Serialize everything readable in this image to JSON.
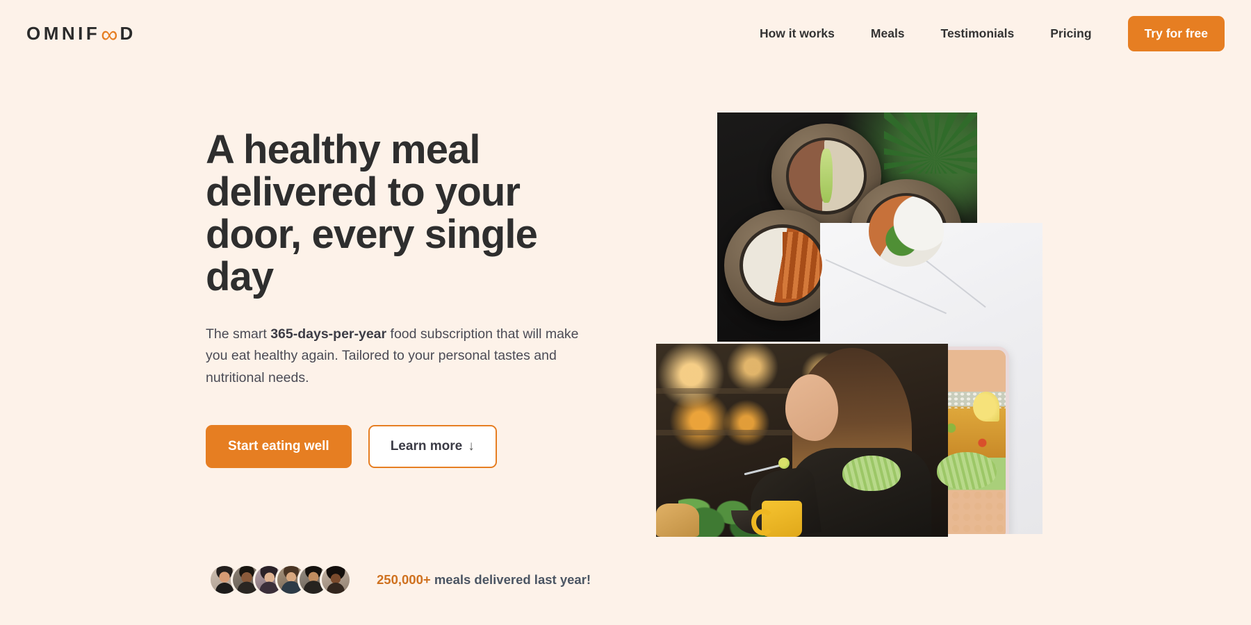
{
  "brand": {
    "name_part1": "OMNIF",
    "name_infinity": "∞",
    "name_part2": "D",
    "accent_color": "#e67e22",
    "background_color": "#fdf2e9",
    "heading_color": "#2e2e2e"
  },
  "nav": {
    "links": [
      {
        "label": "How it works"
      },
      {
        "label": "Meals"
      },
      {
        "label": "Testimonials"
      },
      {
        "label": "Pricing"
      }
    ],
    "cta_label": "Try for free"
  },
  "hero": {
    "title": "A healthy meal delivered to your door, every single day",
    "description_pre": "The smart ",
    "description_bold": "365-days-per-year",
    "description_post": " food subscription that will make you eat healthy again. Tailored to your personal tastes and nutritional needs.",
    "primary_button": "Start eating well",
    "secondary_button": "Learn more",
    "secondary_button_arrow": "↓",
    "delivered_count": "250,000+",
    "delivered_text": " meals delivered last year!",
    "avatar_count": 6,
    "images": [
      {
        "name": "bowls-of-food",
        "alt": "Three ceramic bowls with rice, vegetables and meat on a dark table"
      },
      {
        "name": "meal-prep-containers",
        "alt": "Meal prep containers with chickpeas, rice, curry and avocado on marble"
      },
      {
        "name": "woman-eating",
        "alt": "Woman eating a healthy meal in a warmly lit cafe"
      }
    ]
  }
}
